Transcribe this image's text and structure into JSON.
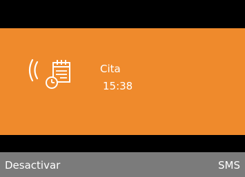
{
  "notification": {
    "type_label": "Cita",
    "time": "15:38",
    "icons": [
      "ringing-icon",
      "appointment-calendar-icon",
      "alarm-clock-icon"
    ]
  },
  "softkeys": {
    "left_label": "Desactivar",
    "right_label": "SMS"
  },
  "colors": {
    "background": "#000000",
    "alert_panel": "#ef8a2c",
    "softkey_bar": "#7b7b7b",
    "text": "#ffffff"
  }
}
